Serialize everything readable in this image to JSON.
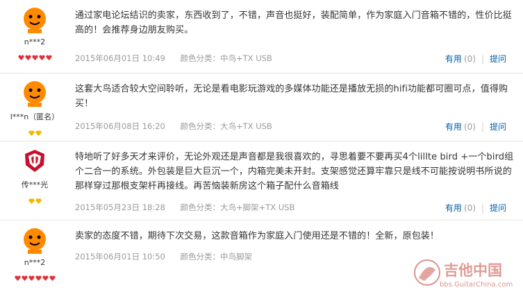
{
  "reviews": [
    {
      "username": "n***2",
      "text": "通过家电论坛结识的卖家，东西收到了，不错，声音也挺好，装配简单，作为家庭入门音箱不错的，性价比挺高的！会推荐身边朋友购买。",
      "date": "2015年06月01日 10:49",
      "color_label": "颜色分类：中鸟+TX USB",
      "useful": "有用",
      "useful_count": "(0)",
      "ask": "提问"
    },
    {
      "username": "l***n（匿名）",
      "text": "这套大鸟适合较大空间聆听，无论是看电影玩游戏的多媒体功能还是播放无损的hifi功能都可圈可点，值得购买！",
      "date": "2015年06月08日 16:20",
      "color_label": "颜色分类：大鸟+TX USB",
      "useful": "有用",
      "useful_count": "(0)",
      "ask": "提问"
    },
    {
      "username": "传***光",
      "text": "特地听了好多天才来评价，无论外观还是声音都是我很喜欢的，寻思着要不要再买4个lillte bird +一个bird组个二合一的系统。外包装是巨大巨沉一个，内箱完美未开封。支架感觉还算牢靠只是线不可能按说明书所说的那样穿过那根支架杆再接线。再苦恼装新房这个箱子配什么音箱线",
      "date": "2015年05月23日 18:28",
      "color_label": "颜色分类：大鸟+脚架+TX USB",
      "useful": "有用",
      "useful_count": "(0)",
      "ask": "提问"
    },
    {
      "username": "n***2",
      "text": "卖家的态度不错，期待下次交易，这款音箱作为家庭入门使用还是不错的！全新，原包装！",
      "date": "2015年06月01日 10:50",
      "color_label": "颜色分类：中鸟脚架",
      "useful": "",
      "useful_count": "",
      "ask": ""
    }
  ],
  "watermark": {
    "cn": "吉他中国",
    "url": "bbs.GuitarChina.com"
  },
  "colors": {
    "link": "#005ea7",
    "meta": "#9a9a9a",
    "badge_red": "#e0303a",
    "badge_gold": "#f3b800"
  }
}
